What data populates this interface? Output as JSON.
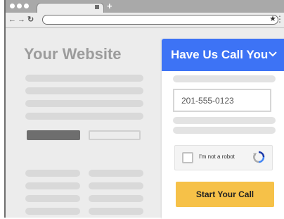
{
  "browser": {
    "new_tab_label": "+",
    "nav_back": "←",
    "nav_forward": "→",
    "nav_reload": "↻",
    "star_icon": "★",
    "menu_icon": "⋮"
  },
  "page": {
    "title": "Your Website"
  },
  "widget": {
    "title": "Have Us Call You",
    "chevron": "∨",
    "accent_color": "#3d73f5",
    "phone_value": "201-555-0123",
    "recaptcha_label": "I'm not a robot",
    "call_button_label": "Start Your Call",
    "call_button_color": "#f6c148"
  }
}
